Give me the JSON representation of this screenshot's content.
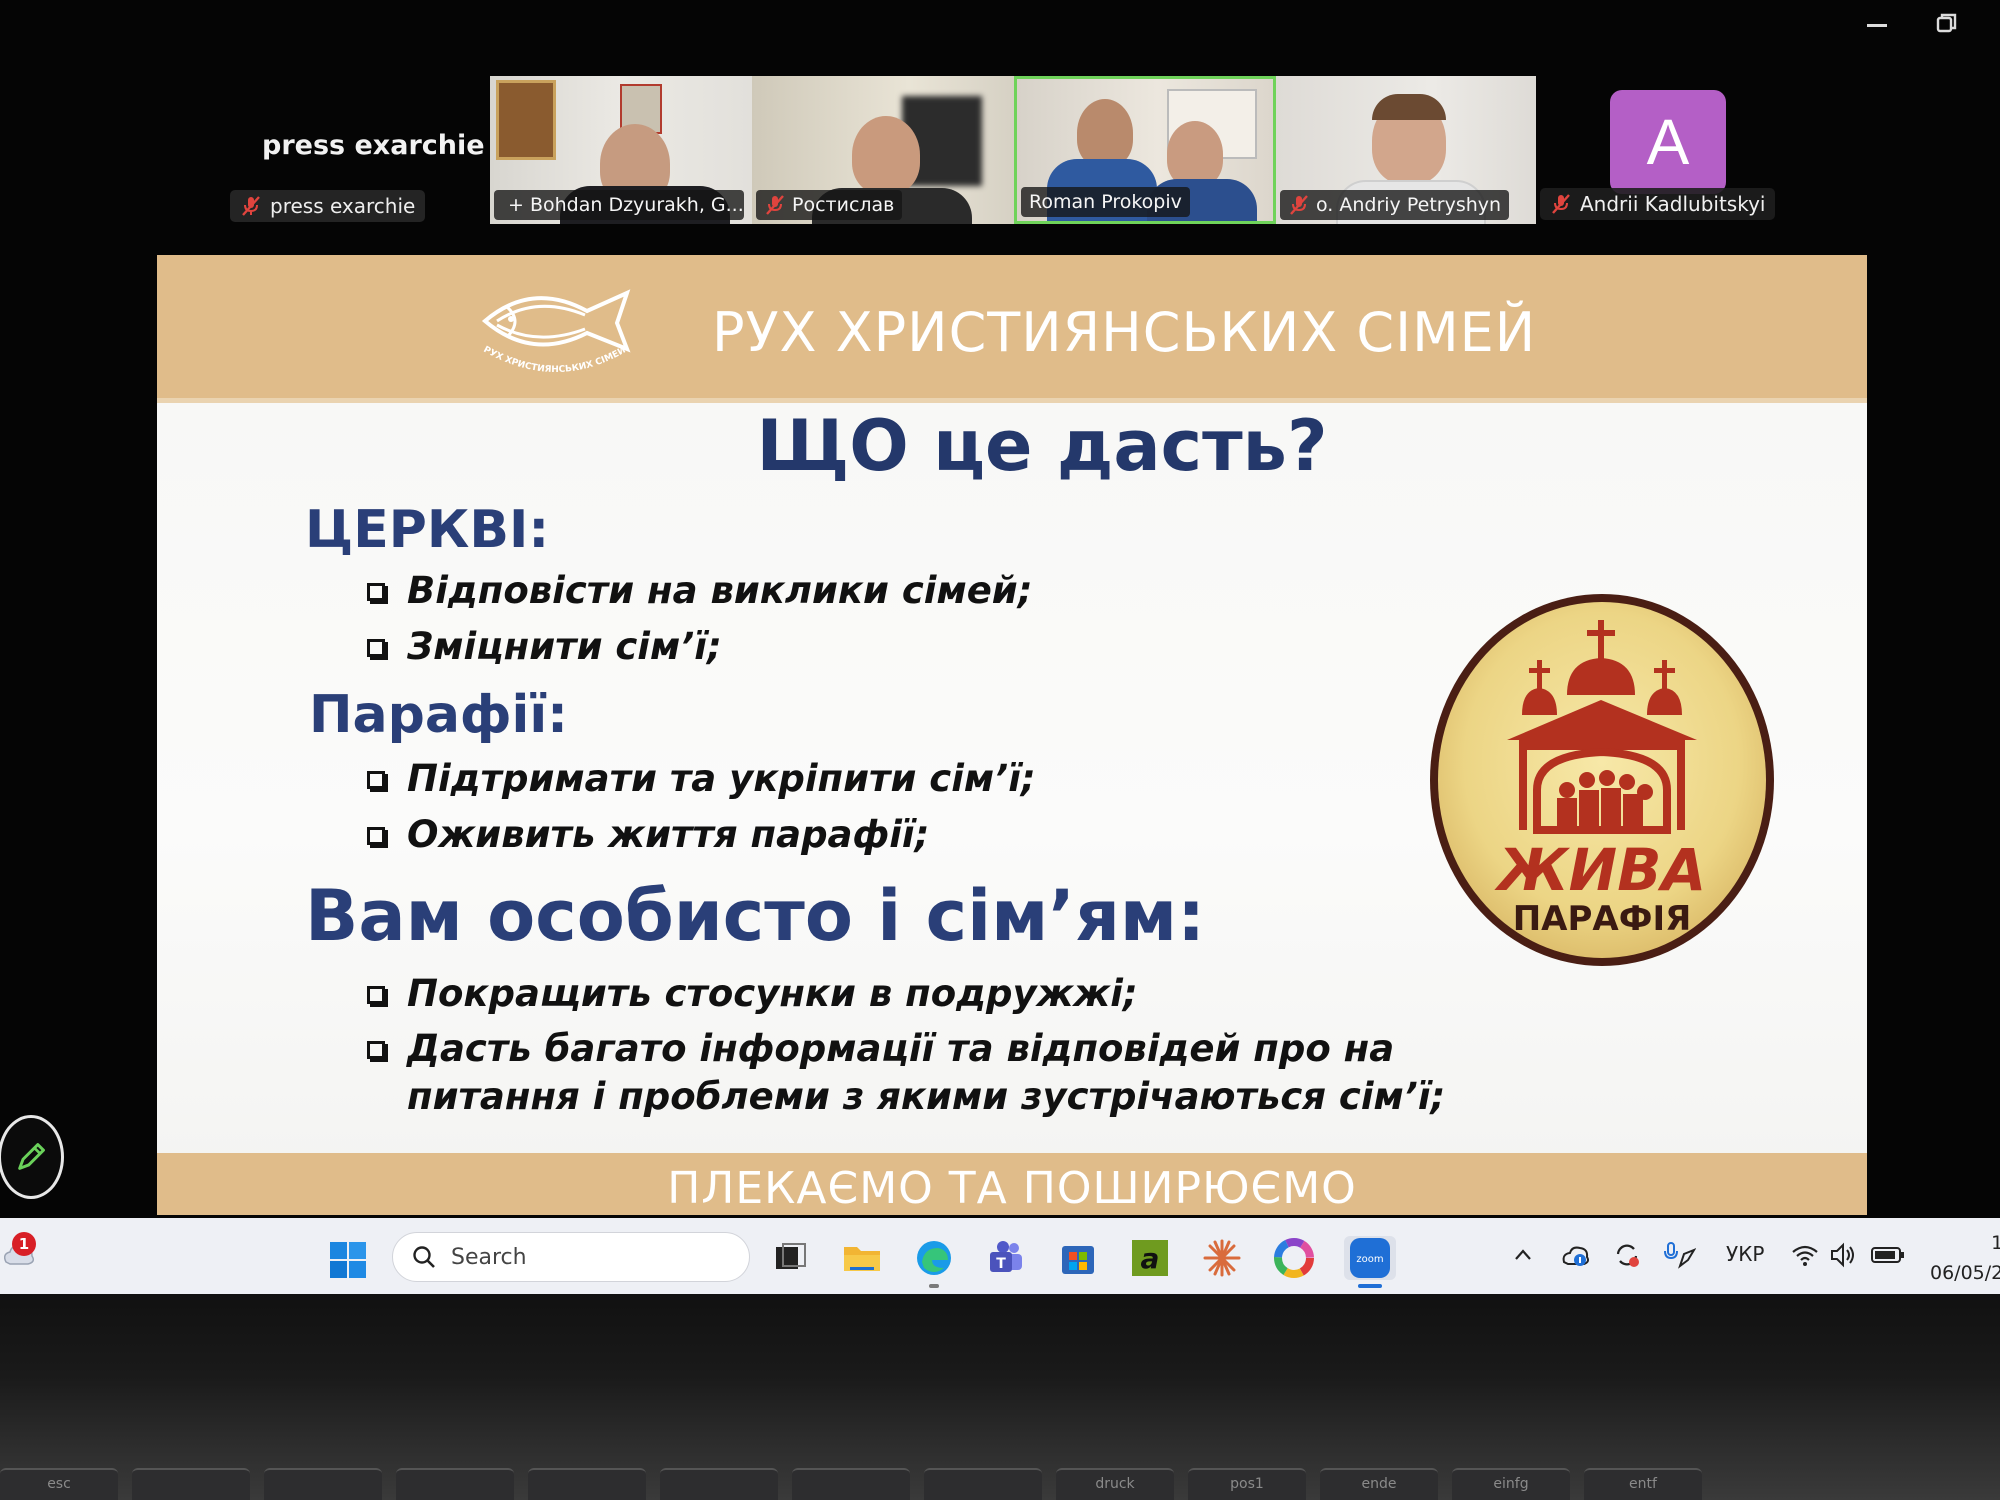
{
  "meeting": {
    "self_name_large": "press exarchie",
    "self_name_chip": "press exarchie",
    "participants": [
      {
        "name": "+ Bohdan Dzyurakh, G..."
      },
      {
        "name": "Ростислав"
      },
      {
        "name": "Roman Prokopiv"
      },
      {
        "name": "o. Andriy Petryshyn"
      },
      {
        "name": "Andrii Kadlubitskyi",
        "initial": "A"
      }
    ]
  },
  "slide": {
    "header_title": "РУХ ХРИСТИЯНСЬКИХ СІМЕЙ",
    "logo_text": "РУХ ХРИСТИЯНСЬКИХ СІМЕЙ",
    "title": "ЩО це дасть?",
    "sections": [
      {
        "heading": "ЦЕРКВІ:",
        "bullets": [
          "Відповісти на виклики сімей;",
          "Зміцнити сім’ї;"
        ]
      },
      {
        "heading": "Парафії:",
        "bullets": [
          "Підтримати та укріпити сім’ї;",
          "Оживить життя парафії;"
        ]
      },
      {
        "heading": "Вам особисто і сім’ям:",
        "bullets": [
          "Покращить стосунки в подружжі;",
          "Дасть багато інформації та відповідей про на питання і проблеми з якими зустрічаються сім’ї;"
        ]
      }
    ],
    "parish_logo": {
      "line1": "ЖИВА",
      "line2": "ПАРАФІЯ"
    },
    "footer": "ПЛЕКАЄМО ТА ПОШИРЮЄМО"
  },
  "taskbar": {
    "notification_count": "1",
    "search_placeholder": "Search",
    "language": "УКР",
    "time": "1",
    "date": "06/05/2",
    "zoom_label": "zoom"
  },
  "keyboard": {
    "keys": [
      "esc",
      "",
      "",
      "",
      "",
      "",
      "",
      "",
      "druck",
      "pos1",
      "ende",
      "einfg",
      "entf"
    ]
  },
  "colors": {
    "header_tan": "#e0bc8a",
    "navy_heading": "#24386b",
    "avatar_purple": "#b45fc6",
    "active_speaker": "#6fd35a",
    "mic_muted": "#e0443e"
  }
}
